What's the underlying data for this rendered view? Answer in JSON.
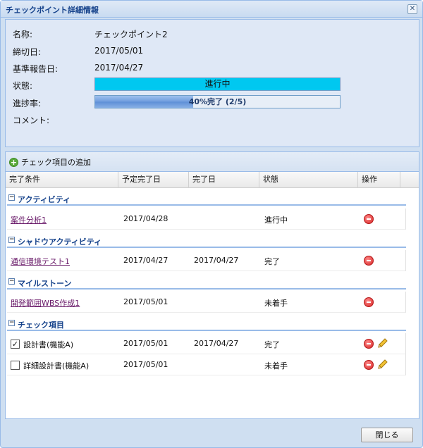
{
  "window": {
    "title": "チェックポイント詳細情報"
  },
  "info": {
    "name_label": "名称:",
    "name_value": "チェックポイント2",
    "deadline_label": "締切日:",
    "deadline_value": "2017/05/01",
    "report_label": "基準報告日:",
    "report_value": "2017/04/27",
    "status_label": "状態:",
    "status_value": "進行中",
    "progress_label": "進捗率:",
    "progress_text": "40%完了 (2/5)",
    "progress_fraction": 0.4,
    "comment_label": "コメント:"
  },
  "toolbar": {
    "add_label": "チェック項目の追加"
  },
  "columns": [
    "完了条件",
    "予定完了日",
    "完了日",
    "状態",
    "操作"
  ],
  "groups": [
    {
      "label": "アクティビティ",
      "rows": [
        {
          "name": "案件分析1",
          "planned": "2017/04/28",
          "done": "",
          "status": "進行中"
        }
      ]
    },
    {
      "label": "シャドウアクティビティ",
      "rows": [
        {
          "name": "通信環境テスト1",
          "planned": "2017/04/27",
          "done": "2017/04/27",
          "status": "完了"
        }
      ]
    },
    {
      "label": "マイルストーン",
      "rows": [
        {
          "name": "開発範囲WBS作成1",
          "planned": "2017/05/01",
          "done": "",
          "status": "未着手"
        }
      ]
    },
    {
      "label": "チェック項目",
      "rows": [
        {
          "name": "設計書(機能A)",
          "checked": true,
          "planned": "2017/05/01",
          "done": "2017/04/27",
          "status": "完了"
        },
        {
          "name": "詳細設計書(機能A)",
          "checked": false,
          "planned": "2017/05/01",
          "done": "",
          "status": "未着手"
        }
      ]
    }
  ],
  "footer": {
    "close_label": "閉じる"
  },
  "icons": {
    "close": "close-icon",
    "add": "add-icon",
    "delete": "delete-icon",
    "edit": "pencil-icon",
    "collapse": "minus-toggle-icon"
  },
  "colors": {
    "status_bar": "#00c8f0",
    "group_text": "#15428b",
    "link": "#6a1b6a"
  }
}
